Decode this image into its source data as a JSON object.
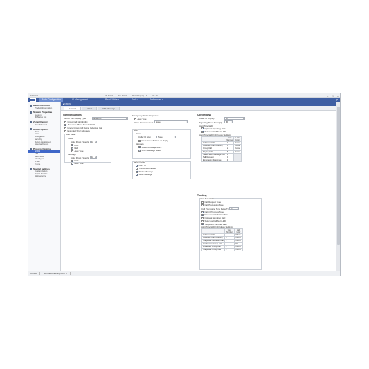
{
  "window": {
    "title": "KPG-D1",
    "model_a": "TK-D240",
    "model_b": "TK-D340",
    "model_c": "Portable(1A)",
    "model_d": "F",
    "model_e": "Ch: 16",
    "help": "?"
  },
  "menubar": {
    "tabs": [
      "Radio Configuration",
      "ID Management",
      "Read / Write ▾",
      "Tools ▾",
      "Preferences ▾"
    ]
  },
  "sidebar": {
    "sections": [
      {
        "title": "Radio Definition",
        "items": [
          "Product Information"
        ]
      },
      {
        "title": "System Properties",
        "items": [
          "System",
          "ID/Status List"
        ]
      },
      {
        "title": "Zone/Channel",
        "items": [
          "Zone/Channel"
        ]
      },
      {
        "title": "Global Options",
        "items": [
          "Basic",
          "Scan",
          "Emergency",
          "Security",
          "Button Assignment",
          "External Device"
        ]
      },
      {
        "title": "Protocol Options",
        "items": [
          "NXDN",
          "LTR",
          "MDC-1200",
          "FleetSync",
          "DTMF",
          "2-tone"
        ]
      },
      {
        "title": "Special Settings",
        "items": [
          "Customization",
          "Digital Profiles",
          "Maintenance"
        ]
      }
    ],
    "selected": "NXDN"
  },
  "content": {
    "title": "▸ NXDN",
    "tabs": [
      "General",
      "Status",
      "CW Message"
    ],
    "common": {
      "heading": "Common Options",
      "group_call_label": "Group Call Display Type",
      "group_call_value": "Group ID",
      "checks": [
        {
          "label": "Group Call Alert Inhibit",
          "on": false
        },
        {
          "label": "Alert Tone Mixed from 2nd Call",
          "on": true
        },
        {
          "label": "Ignore Group Call during Individual Call",
          "on": false
        },
        {
          "label": "Extended Short Message",
          "on": false
        }
      ]
    },
    "auto_reset": {
      "heading": "Auto Reset",
      "voice": "Voice",
      "timer_label": "Auto Reset Timer [s]",
      "timer_value": "10",
      "voice_checks": [
        {
          "label": "LCD",
          "on": true
        },
        {
          "label": "LED",
          "on": true
        },
        {
          "label": "Alert Tone",
          "on": true
        }
      ],
      "message": "Message",
      "msg_timer_value": "10",
      "msg_checks": [
        {
          "label": "LCD",
          "on": true
        },
        {
          "label": "Alert Tone",
          "on": true
        }
      ]
    },
    "emergency": {
      "heading": "Emergency Status Response",
      "alert_tone": "Alert Tone",
      "voice_ann_label": "Voice Announcement",
      "voice_ann_value": "None"
    },
    "stun": {
      "heading": "Stun",
      "voice": "Voice",
      "caller_label": "Caller ID Stun",
      "caller_value": "None",
      "clear": "Clear Caller ID Stun on Reply",
      "message": "Message",
      "msg_checks": [
        {
          "label": "Status Message Stack",
          "on": true
        },
        {
          "label": "Short Message Stack",
          "on": true
        }
      ]
    },
    "serial": {
      "heading": "Serial Output",
      "checks": [
        {
          "label": "UNIT ID",
          "on": true
        },
        {
          "label": "Transmitted Header",
          "on": false
        },
        {
          "label": "Status Message",
          "on": true
        },
        {
          "label": "Short Message",
          "on": true
        }
      ]
    },
    "conventional": {
      "heading": "Conventional",
      "caller_label": "Caller ID Display",
      "caller_value": "Off",
      "sig_label": "Signaling Reset Timer [s]",
      "sig_value": "30",
      "alert_heading": "Alert Tone/LED",
      "alert_checks": [
        {
          "label": "Optional Signaling LED",
          "on": true
        },
        {
          "label": "Selective Call Alert LED",
          "on": true
        }
      ],
      "table_heading": "Alert Tone/LED Individually Settings",
      "col1": "Tone Number",
      "col2": "LED Color",
      "rows": [
        [
          "Individual Call",
          "1",
          "Yellow"
        ],
        [
          "Individual Call Incoming",
          "6",
          "Yellow"
        ],
        [
          "Group Call",
          "2",
          "Yellow"
        ],
        [
          "Paging Call",
          "6",
          "Yellow"
        ],
        [
          "Status/Short Message Call",
          "3",
          ""
        ],
        [
          "Talk Request",
          "3",
          ""
        ],
        [
          "Emergency Response",
          "4",
          ""
        ]
      ]
    },
    "trunking": {
      "heading": "Trunking",
      "alert_heading": "Alert Tone/LED",
      "checks": [
        {
          "label": "Call Request Tone",
          "on": false
        },
        {
          "label": "Call Processing Tone",
          "on": false
        }
      ],
      "cpt_label": "Call Processing Tone Delay Time [s]",
      "cpt_value": "0.5",
      "checks2": [
        {
          "label": "Call in Progress Tone",
          "on": true
        },
        {
          "label": "Disconnect Indication Tone",
          "on": true
        },
        {
          "label": "Optional Signaling LED",
          "on": false
        },
        {
          "label": "Selective Call Alert LED",
          "on": false
        },
        {
          "label": "Telephone Call Alert LED",
          "on": true
        }
      ],
      "table_heading": "Alert Tone/LED Individually Settings",
      "col1": "Tone Number",
      "col2": "LED Color",
      "rows": [
        [
          "Individual Call",
          "1",
          "Yellow"
        ],
        [
          "Individual Call Incoming",
          "6",
          "Yellow"
        ],
        [
          "Telephone Individual Call",
          "2",
          "Yellow"
        ],
        [
          "Conference Group Call",
          "1",
          "Off"
        ],
        [
          "Broadcast Group Call",
          "4",
          "Yellow"
        ],
        [
          "Telephone Group Call",
          "4",
          "Yellow"
        ]
      ]
    }
  },
  "status": {
    "left": "CCMA",
    "right": "Number of Editing Item: 0"
  }
}
